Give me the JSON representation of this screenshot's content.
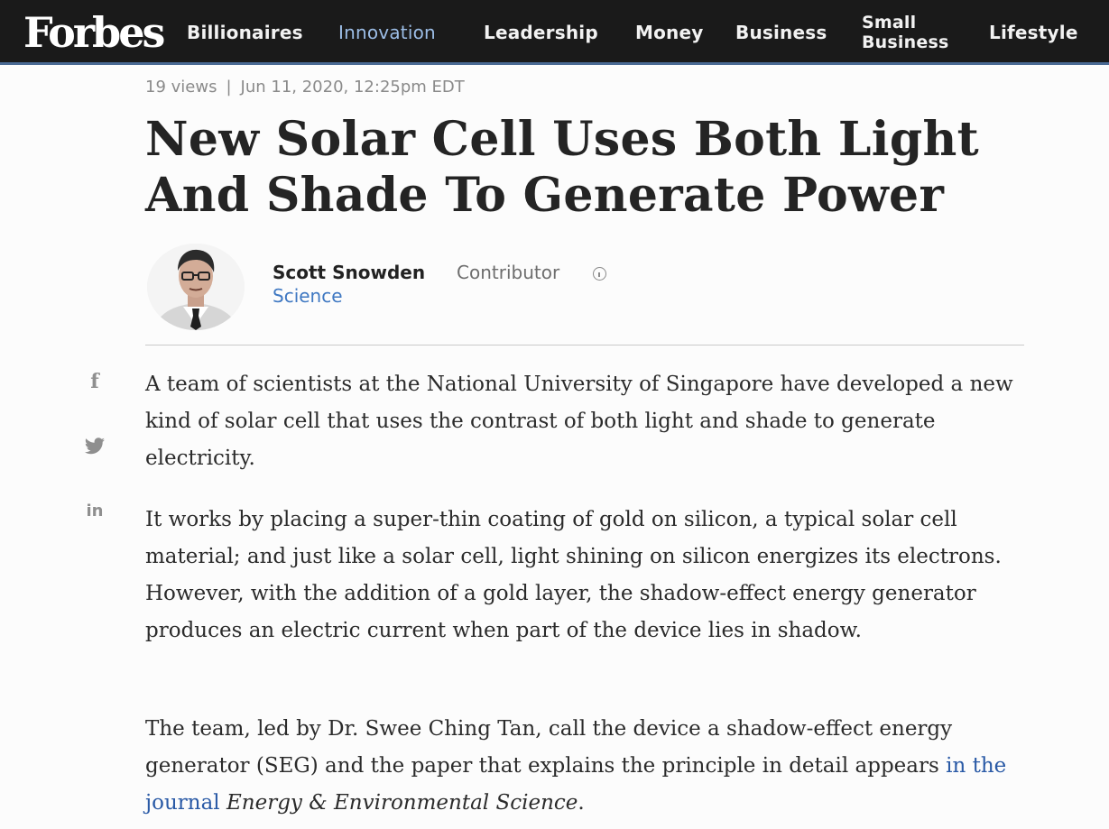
{
  "brand": {
    "logo_text": "Forbes"
  },
  "nav": {
    "items": [
      {
        "label": "Billionaires",
        "active": false
      },
      {
        "label": "Innovation",
        "active": true
      },
      {
        "label": "Leadership",
        "active": false
      },
      {
        "label": "Money",
        "active": false
      },
      {
        "label": "Business",
        "active": false
      },
      {
        "label": "Small Business",
        "active": false
      },
      {
        "label": "Lifestyle",
        "active": false
      }
    ]
  },
  "article": {
    "views": "19 views",
    "separator": "|",
    "date": "Jun 11, 2020, 12:25pm EDT",
    "headline": "New Solar Cell Uses Both Light And Shade To Generate Power",
    "author": {
      "name": "Scott Snowden",
      "role": "Contributor",
      "section": "Science"
    },
    "share": {
      "facebook_glyph": "f",
      "linkedin_glyph": "in"
    },
    "paragraphs": [
      "A team of scientists at the National University of Singapore have developed a new kind of solar cell that uses the contrast of both light and shade to generate electricity.",
      "It works by placing a super-thin coating of gold on silicon, a typical solar cell material; and just like a solar cell, light shining on silicon energizes its electrons. However, with the addition of a gold layer, the shadow-effect energy generator produces an electric current when part of the device lies in shadow."
    ],
    "p3": {
      "text_before": "The team, led by Dr. Swee Ching Tan, call the device a shadow-effect energy generator (SEG) and the paper that explains the principle in detail appears ",
      "link_text": "in the journal",
      "space": " ",
      "journal": "Energy & Environmental Science",
      "end": "."
    }
  },
  "colors": {
    "nav_bg": "#1a1a1a",
    "nav_active": "#9cbde6",
    "accent_link": "#3f78c2",
    "body_link": "#2a5aa6"
  },
  "icons": {
    "facebook": "facebook-icon",
    "twitter": "twitter-icon",
    "linkedin": "linkedin-icon",
    "info": "info-icon"
  }
}
